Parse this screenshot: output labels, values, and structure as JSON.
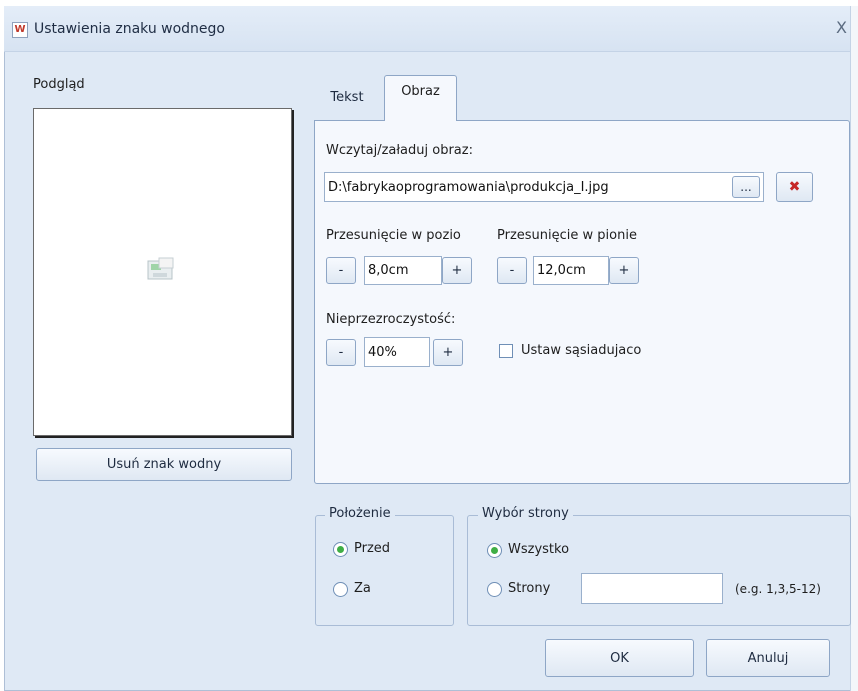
{
  "dialog": {
    "app_icon": "W",
    "title": "Ustawienia znaku wodnego",
    "close_glyph": "X"
  },
  "preview": {
    "label": "Podgląd",
    "remove_button": "Usuń znak wodny"
  },
  "tabs": [
    {
      "label": "Tekst",
      "active": false
    },
    {
      "label": "Obraz",
      "active": true
    }
  ],
  "image_tab": {
    "load_label": "Wczytaj/załaduj obraz:",
    "file_path": "D:\\fabrykaoprogramowania\\produkcja_I.jpg",
    "browse_label": "...",
    "clear_glyph": "✖",
    "h_offset_label": "Przesunięcie w pozio",
    "v_offset_label": "Przesunięcie w pionie",
    "h_offset_value": "8,0cm",
    "v_offset_value": "12,0cm",
    "opacity_label": "Nieprzezroczystość:",
    "opacity_value": "40%",
    "minus": "-",
    "plus": "+",
    "tile_label": "Ustaw sąsiadujaco",
    "tile_checked": false
  },
  "position_group": {
    "title": "Położenie",
    "options": [
      "Przed",
      "Za"
    ],
    "selected": "Przed"
  },
  "page_group": {
    "title": "Wybór strony",
    "all_label": "Wszystko",
    "pages_label": "Strony",
    "pages_value": "",
    "pages_hint": "(e.g. 1,3,5-12)",
    "selected": "Wszystko"
  },
  "buttons": {
    "ok": "OK",
    "cancel": "Anuluj"
  },
  "colors": {
    "dialog_bg": "#dfe9f5",
    "panel_bg": "#f5f8fd",
    "radio_selected": "#3fae45",
    "clear_icon": "#c62828"
  }
}
